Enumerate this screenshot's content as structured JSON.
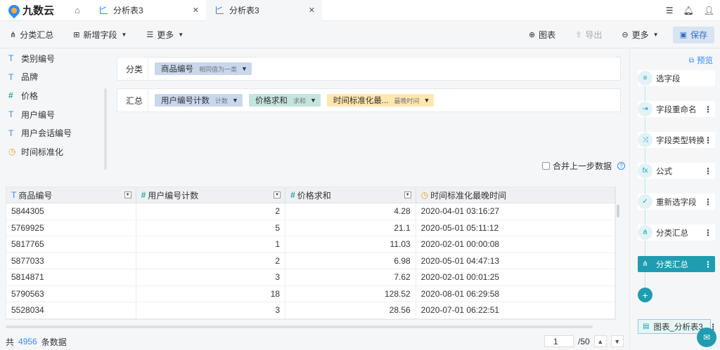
{
  "app": {
    "logo_text": "九数云",
    "brand_color": "#2f8cff",
    "accent_color": "#1f9db0"
  },
  "tabs": [
    {
      "label": "分析表3",
      "active": false
    },
    {
      "label": "分析表3",
      "active": true
    }
  ],
  "top_icons": [
    "list-icon",
    "bell-icon",
    "user-icon"
  ],
  "toolbar": {
    "group_summary": "分类汇总",
    "add_field": "新增字段",
    "more_left": "更多",
    "chart": "图表",
    "export": "导出",
    "more_right": "更多",
    "save": "保存"
  },
  "fields": [
    {
      "icon": "T",
      "type": "text",
      "label": "类别编号"
    },
    {
      "icon": "T",
      "type": "text",
      "label": "品牌"
    },
    {
      "icon": "#",
      "type": "number",
      "label": "价格"
    },
    {
      "icon": "T",
      "type": "text",
      "label": "用户编号"
    },
    {
      "icon": "T",
      "type": "text",
      "label": "用户会话编号"
    },
    {
      "icon": "◷",
      "type": "time",
      "label": "时间标准化"
    }
  ],
  "group_by": {
    "label": "分类",
    "chips": [
      {
        "name": "商品编号",
        "sub": "相同值为一类"
      }
    ]
  },
  "summary": {
    "label": "汇总",
    "chips": [
      {
        "name": "用户编号计数",
        "sub": "计数"
      },
      {
        "name": "价格求和",
        "sub": "求和"
      },
      {
        "name": "时间标准化最...",
        "sub": "最晚时间"
      }
    ]
  },
  "merge_prev": "合并上一步数据",
  "table": {
    "columns": [
      {
        "icon": "T",
        "label": "商品编号"
      },
      {
        "icon": "#",
        "label": "用户编号计数"
      },
      {
        "icon": "#",
        "label": "价格求和"
      },
      {
        "icon": "◷",
        "label": "时间标准化最晚时间"
      }
    ],
    "rows": [
      [
        "5844305",
        "2",
        "4.28",
        "2020-04-01 03:16:27"
      ],
      [
        "5769925",
        "5",
        "21.1",
        "2020-05-01 05:11:12"
      ],
      [
        "5817765",
        "1",
        "11.03",
        "2020-02-01 00:00:08"
      ],
      [
        "5877033",
        "2",
        "6.98",
        "2020-05-01 04:47:13"
      ],
      [
        "5814871",
        "3",
        "7.62",
        "2020-02-01 00:01:25"
      ],
      [
        "5790563",
        "18",
        "128.52",
        "2020-08-01 06:29:58"
      ],
      [
        "5528034",
        "3",
        "28.56",
        "2020-07-01 06:22:51"
      ]
    ]
  },
  "footer": {
    "prefix": "共",
    "count": "4956",
    "suffix": "条数据",
    "page": "1",
    "total_pages": "/50"
  },
  "steps": {
    "preview": "预览",
    "items": [
      {
        "label": "选字段",
        "icon": "≡",
        "more": false
      },
      {
        "label": "字段重命名",
        "icon": "⇥",
        "more": true
      },
      {
        "label": "字段类型转换",
        "icon": "⤨",
        "more": true
      },
      {
        "label": "公式",
        "icon": "fx",
        "more": true
      },
      {
        "label": "重新选字段",
        "icon": "✓",
        "more": true
      },
      {
        "label": "分类汇总",
        "icon": "⋔",
        "more": true
      },
      {
        "label": "分类汇总",
        "icon": "⋔",
        "more": true,
        "active": true
      }
    ],
    "chart_step": "图表_分析表3"
  }
}
